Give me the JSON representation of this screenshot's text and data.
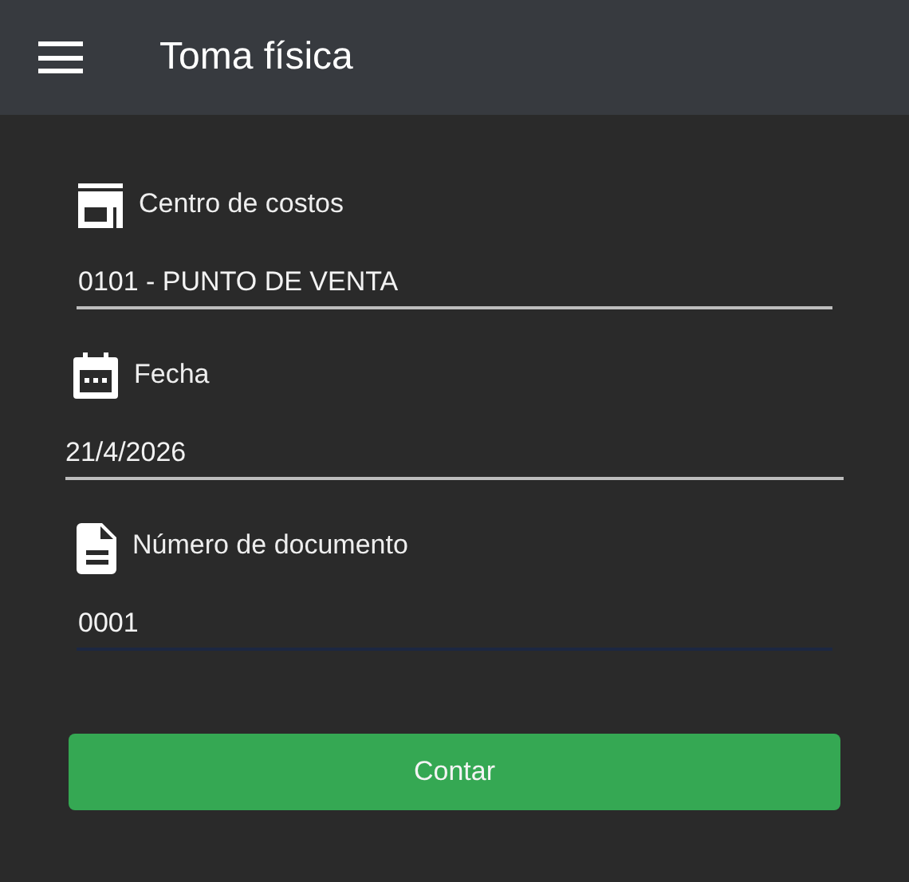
{
  "header": {
    "title": "Toma física"
  },
  "fields": [
    {
      "kind": "text",
      "label": "Centro de costos",
      "value": "0101 - PUNTO DE VENTA",
      "focused": false
    },
    {
      "kind": "date",
      "label": "Fecha",
      "value": "21/4/2026",
      "focused": false
    },
    {
      "kind": "text",
      "label": "Número de documento",
      "value": "0001",
      "focused": true
    }
  ],
  "button": {
    "label": "Contar"
  }
}
